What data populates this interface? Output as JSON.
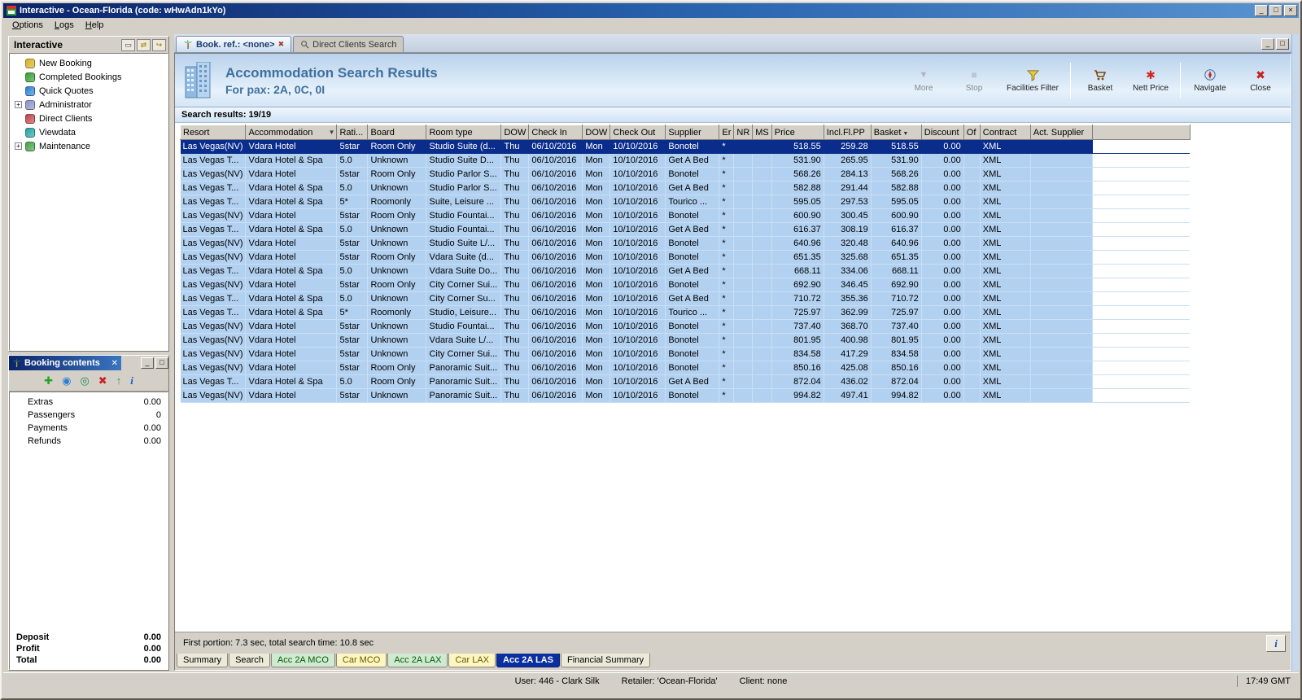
{
  "window": {
    "title": "Interactive - Ocean-Florida (code: wHwAdn1kYo)"
  },
  "menu": {
    "items": [
      "Options",
      "Logs",
      "Help"
    ]
  },
  "sidebar": {
    "title": "Interactive",
    "items": [
      {
        "label": "New Booking",
        "expandable": false,
        "icon": "new-booking-icon",
        "color": "#d8b020"
      },
      {
        "label": "Completed Bookings",
        "expandable": false,
        "icon": "completed-bookings-icon",
        "color": "#2e9e2e"
      },
      {
        "label": "Quick Quotes",
        "expandable": false,
        "icon": "quick-quotes-icon",
        "color": "#2a7fd4"
      },
      {
        "label": "Administrator",
        "expandable": true,
        "icon": "administrator-icon",
        "color": "#8890c8"
      },
      {
        "label": "Direct Clients",
        "expandable": false,
        "icon": "direct-clients-icon",
        "color": "#c04040"
      },
      {
        "label": "Viewdata",
        "expandable": false,
        "icon": "viewdata-icon",
        "color": "#20a0a0"
      },
      {
        "label": "Maintenance",
        "expandable": true,
        "icon": "maintenance-icon",
        "color": "#40a040"
      }
    ]
  },
  "booking_contents": {
    "title": "Booking contents",
    "toolbar": [
      "add-icon",
      "world-icon",
      "export-icon",
      "delete-icon",
      "move-up-icon",
      "info-icon"
    ],
    "rows": [
      {
        "label": "Extras",
        "value": "0.00"
      },
      {
        "label": "Passengers",
        "value": "0"
      },
      {
        "label": "Payments",
        "value": "0.00"
      },
      {
        "label": "Refunds",
        "value": "0.00"
      }
    ],
    "totals": [
      {
        "label": "Deposit",
        "value": "0.00"
      },
      {
        "label": "Profit",
        "value": "0.00"
      },
      {
        "label": "Total",
        "value": "0.00"
      }
    ]
  },
  "doc_tabs": {
    "active": "Book. ref.: <none>",
    "inactive": "Direct Clients Search"
  },
  "header": {
    "title": "Accommodation Search Results",
    "subtitle": "For pax: 2A, 0C, 0I",
    "buttons": [
      {
        "label": "More",
        "icon": "more-icon",
        "disabled": true
      },
      {
        "label": "Stop",
        "icon": "stop-icon",
        "disabled": true
      },
      {
        "label": "Facilities Filter",
        "icon": "filter-icon",
        "disabled": false,
        "wide": true
      },
      {
        "sep": true
      },
      {
        "label": "Basket",
        "icon": "basket-icon",
        "disabled": false
      },
      {
        "label": "Nett Price",
        "icon": "nett-price-icon",
        "disabled": false
      },
      {
        "sep": true
      },
      {
        "label": "Navigate",
        "icon": "navigate-icon",
        "disabled": false
      },
      {
        "label": "Close",
        "icon": "close-icon",
        "disabled": false
      }
    ]
  },
  "results": {
    "label": "Search results: 19/19"
  },
  "table": {
    "columns": [
      "Resort",
      "Accommodation",
      "Rati...",
      "Board",
      "Room type",
      "DOW",
      "Check In",
      "DOW",
      "Check Out",
      "Supplier",
      "Er",
      "NR",
      "MS",
      "Price",
      "Incl.Fl.PP",
      "Basket",
      "Discount",
      "Of",
      "Contract",
      "Act. Supplier"
    ],
    "selected_row": 0,
    "rows": [
      [
        "Las Vegas(NV)",
        "Vdara Hotel",
        "5star",
        "Room Only",
        "Studio Suite (d...",
        "Thu",
        "06/10/2016",
        "Mon",
        "10/10/2016",
        "Bonotel",
        "*",
        "",
        "",
        "518.55",
        "259.28",
        "518.55",
        "0.00",
        "",
        "XML",
        ""
      ],
      [
        "Las Vegas T...",
        "Vdara Hotel & Spa",
        "5.0",
        "Unknown",
        "Studio Suite D...",
        "Thu",
        "06/10/2016",
        "Mon",
        "10/10/2016",
        "Get A Bed",
        "*",
        "",
        "",
        "531.90",
        "265.95",
        "531.90",
        "0.00",
        "",
        "XML",
        ""
      ],
      [
        "Las Vegas(NV)",
        "Vdara Hotel",
        "5star",
        "Room Only",
        "Studio Parlor S...",
        "Thu",
        "06/10/2016",
        "Mon",
        "10/10/2016",
        "Bonotel",
        "*",
        "",
        "",
        "568.26",
        "284.13",
        "568.26",
        "0.00",
        "",
        "XML",
        ""
      ],
      [
        "Las Vegas T...",
        "Vdara Hotel & Spa",
        "5.0",
        "Unknown",
        "Studio Parlor S...",
        "Thu",
        "06/10/2016",
        "Mon",
        "10/10/2016",
        "Get A Bed",
        "*",
        "",
        "",
        "582.88",
        "291.44",
        "582.88",
        "0.00",
        "",
        "XML",
        ""
      ],
      [
        "Las Vegas T...",
        "Vdara Hotel & Spa",
        "5*",
        "Roomonly",
        "Suite, Leisure ...",
        "Thu",
        "06/10/2016",
        "Mon",
        "10/10/2016",
        "Tourico ...",
        "*",
        "",
        "",
        "595.05",
        "297.53",
        "595.05",
        "0.00",
        "",
        "XML",
        ""
      ],
      [
        "Las Vegas(NV)",
        "Vdara Hotel",
        "5star",
        "Room Only",
        "Studio Fountai...",
        "Thu",
        "06/10/2016",
        "Mon",
        "10/10/2016",
        "Bonotel",
        "*",
        "",
        "",
        "600.90",
        "300.45",
        "600.90",
        "0.00",
        "",
        "XML",
        ""
      ],
      [
        "Las Vegas T...",
        "Vdara Hotel & Spa",
        "5.0",
        "Unknown",
        "Studio Fountai...",
        "Thu",
        "06/10/2016",
        "Mon",
        "10/10/2016",
        "Get A Bed",
        "*",
        "",
        "",
        "616.37",
        "308.19",
        "616.37",
        "0.00",
        "",
        "XML",
        ""
      ],
      [
        "Las Vegas(NV)",
        "Vdara Hotel",
        "5star",
        "Unknown",
        "Studio Suite L/...",
        "Thu",
        "06/10/2016",
        "Mon",
        "10/10/2016",
        "Bonotel",
        "*",
        "",
        "",
        "640.96",
        "320.48",
        "640.96",
        "0.00",
        "",
        "XML",
        ""
      ],
      [
        "Las Vegas(NV)",
        "Vdara Hotel",
        "5star",
        "Room Only",
        "Vdara Suite (d...",
        "Thu",
        "06/10/2016",
        "Mon",
        "10/10/2016",
        "Bonotel",
        "*",
        "",
        "",
        "651.35",
        "325.68",
        "651.35",
        "0.00",
        "",
        "XML",
        ""
      ],
      [
        "Las Vegas T...",
        "Vdara Hotel & Spa",
        "5.0",
        "Unknown",
        "Vdara Suite Do...",
        "Thu",
        "06/10/2016",
        "Mon",
        "10/10/2016",
        "Get A Bed",
        "*",
        "",
        "",
        "668.11",
        "334.06",
        "668.11",
        "0.00",
        "",
        "XML",
        ""
      ],
      [
        "Las Vegas(NV)",
        "Vdara Hotel",
        "5star",
        "Room Only",
        "City Corner Sui...",
        "Thu",
        "06/10/2016",
        "Mon",
        "10/10/2016",
        "Bonotel",
        "*",
        "",
        "",
        "692.90",
        "346.45",
        "692.90",
        "0.00",
        "",
        "XML",
        ""
      ],
      [
        "Las Vegas T...",
        "Vdara Hotel & Spa",
        "5.0",
        "Unknown",
        "City Corner Su...",
        "Thu",
        "06/10/2016",
        "Mon",
        "10/10/2016",
        "Get A Bed",
        "*",
        "",
        "",
        "710.72",
        "355.36",
        "710.72",
        "0.00",
        "",
        "XML",
        ""
      ],
      [
        "Las Vegas T...",
        "Vdara Hotel & Spa",
        "5*",
        "Roomonly",
        "Studio, Leisure...",
        "Thu",
        "06/10/2016",
        "Mon",
        "10/10/2016",
        "Tourico ...",
        "*",
        "",
        "",
        "725.97",
        "362.99",
        "725.97",
        "0.00",
        "",
        "XML",
        ""
      ],
      [
        "Las Vegas(NV)",
        "Vdara Hotel",
        "5star",
        "Unknown",
        "Studio Fountai...",
        "Thu",
        "06/10/2016",
        "Mon",
        "10/10/2016",
        "Bonotel",
        "*",
        "",
        "",
        "737.40",
        "368.70",
        "737.40",
        "0.00",
        "",
        "XML",
        ""
      ],
      [
        "Las Vegas(NV)",
        "Vdara Hotel",
        "5star",
        "Unknown",
        "Vdara Suite L/...",
        "Thu",
        "06/10/2016",
        "Mon",
        "10/10/2016",
        "Bonotel",
        "*",
        "",
        "",
        "801.95",
        "400.98",
        "801.95",
        "0.00",
        "",
        "XML",
        ""
      ],
      [
        "Las Vegas(NV)",
        "Vdara Hotel",
        "5star",
        "Unknown",
        "City Corner Sui...",
        "Thu",
        "06/10/2016",
        "Mon",
        "10/10/2016",
        "Bonotel",
        "*",
        "",
        "",
        "834.58",
        "417.29",
        "834.58",
        "0.00",
        "",
        "XML",
        ""
      ],
      [
        "Las Vegas(NV)",
        "Vdara Hotel",
        "5star",
        "Room Only",
        "Panoramic Suit...",
        "Thu",
        "06/10/2016",
        "Mon",
        "10/10/2016",
        "Bonotel",
        "*",
        "",
        "",
        "850.16",
        "425.08",
        "850.16",
        "0.00",
        "",
        "XML",
        ""
      ],
      [
        "Las Vegas T...",
        "Vdara Hotel & Spa",
        "5.0",
        "Room Only",
        "Panoramic Suit...",
        "Thu",
        "06/10/2016",
        "Mon",
        "10/10/2016",
        "Get A Bed",
        "*",
        "",
        "",
        "872.04",
        "436.02",
        "872.04",
        "0.00",
        "",
        "XML",
        ""
      ],
      [
        "Las Vegas(NV)",
        "Vdara Hotel",
        "5star",
        "Unknown",
        "Panoramic Suit...",
        "Thu",
        "06/10/2016",
        "Mon",
        "10/10/2016",
        "Bonotel",
        "*",
        "",
        "",
        "994.82",
        "497.41",
        "994.82",
        "0.00",
        "",
        "XML",
        ""
      ]
    ]
  },
  "footer": {
    "timing": "First portion: 7.3 sec, total search time: 10.8 sec"
  },
  "bottom_tabs": [
    {
      "label": "Summary",
      "type": "plain",
      "active": false
    },
    {
      "label": "Search",
      "type": "plain",
      "active": false
    },
    {
      "label": "Acc 2A MCO",
      "type": "acc",
      "active": false
    },
    {
      "label": "Car MCO",
      "type": "car",
      "active": false
    },
    {
      "label": "Acc 2A LAX",
      "type": "acc",
      "active": false
    },
    {
      "label": "Car LAX",
      "type": "car",
      "active": false
    },
    {
      "label": "Acc 2A LAS",
      "type": "acc",
      "active": true
    },
    {
      "label": "Financial Summary",
      "type": "plain",
      "active": false
    }
  ],
  "status": {
    "user": "User: 446 - Clark Silk",
    "retailer": "Retailer: 'Ocean-Florida'",
    "client": "Client: none",
    "time": "17:49 GMT"
  },
  "colors": {
    "selection": "#0a2d8c",
    "row_blue": "#b2d1f0",
    "active_bottom_tab": "#0a2fa0",
    "title_accent": "#40709f"
  }
}
